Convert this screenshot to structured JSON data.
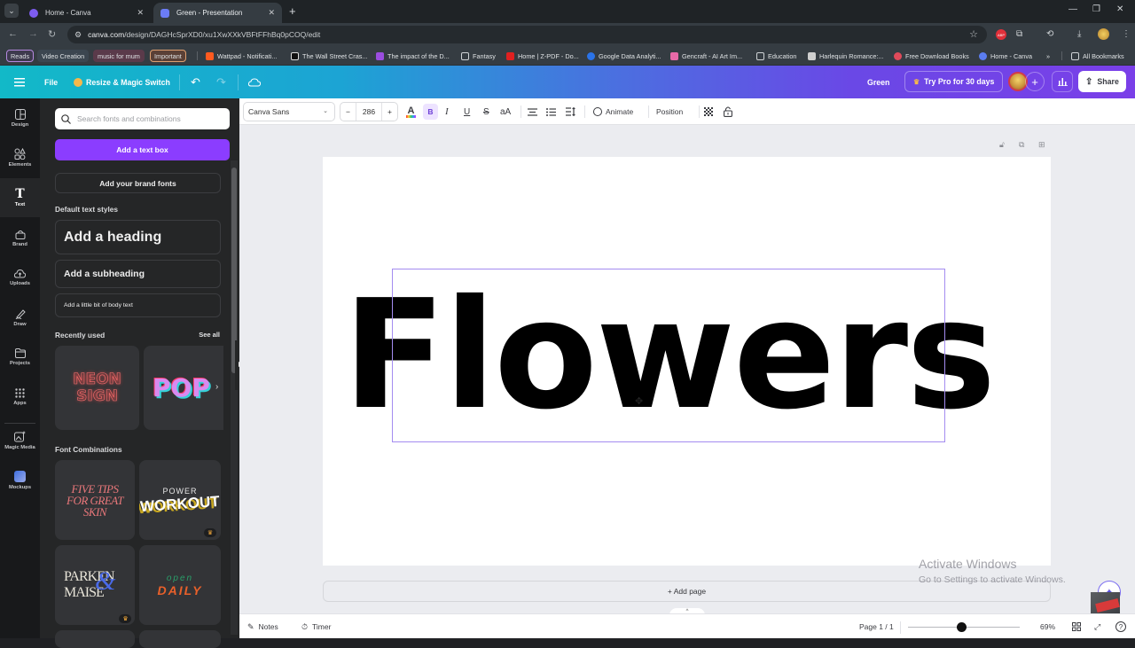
{
  "browser": {
    "tabs": [
      {
        "title": "Home - Canva",
        "active": false,
        "favicon_color": "#7d5cf0"
      },
      {
        "title": "Green - Presentation",
        "active": true,
        "favicon_color": "#6b7cf5"
      }
    ],
    "new_tab": "+",
    "window_controls": {
      "minimize": "—",
      "maximize": "❐",
      "close": "✕"
    },
    "url": {
      "domain": "canva.com",
      "path": "/design/DAGHcSprXD0/xu1XwXXkVBFtFFhBq0pCOQ/edit"
    },
    "bookmarks": [
      {
        "label": "Reads",
        "type": "group",
        "color": "#b589e0"
      },
      {
        "label": "Video Creation",
        "type": "group",
        "color": "#8ea6c0"
      },
      {
        "label": "music for mum",
        "type": "group",
        "color": "#d67ea0"
      },
      {
        "label": "Important",
        "type": "group",
        "color": "#e0a070"
      },
      {
        "label": "Wattpad - Notificati...",
        "type": "link",
        "icon": "wattpad-icon",
        "color": "#ff5a1f"
      },
      {
        "label": "The Wall Street Cras...",
        "type": "link",
        "icon": "h-icon",
        "color": "#111111"
      },
      {
        "label": "The impact of the D...",
        "type": "link",
        "icon": "book-icon",
        "color": "#9b4de0"
      },
      {
        "label": "Fantasy",
        "type": "folder"
      },
      {
        "label": "Home | Z-PDF - Do...",
        "type": "link",
        "icon": "z-icon",
        "color": "#e02020"
      },
      {
        "label": "Google Data Analyti...",
        "type": "link",
        "icon": "coursera-icon",
        "color": "#2a73e8"
      },
      {
        "label": "Gencraft - AI Art Im...",
        "type": "link",
        "icon": "gencraft-icon",
        "color": "#e86aa8"
      },
      {
        "label": "Education",
        "type": "folder"
      },
      {
        "label": "Harlequin Romance:...",
        "type": "link",
        "icon": "harlequin-icon",
        "color": "#cfcfcf"
      },
      {
        "label": "Free Download Books",
        "type": "link",
        "icon": "books-icon",
        "color": "#e04a5a"
      },
      {
        "label": "Home - Canva",
        "type": "link",
        "icon": "canva-icon",
        "color": "#5b7df0"
      }
    ],
    "overflow": "»",
    "all_bookmarks": "All Bookmarks"
  },
  "header": {
    "file": "File",
    "resize": "Resize & Magic Switch",
    "design_name": "Green",
    "try_pro": "Try Pro for 30 days",
    "share": "Share"
  },
  "rail": [
    {
      "label": "Design",
      "icon": "design-icon",
      "active": false
    },
    {
      "label": "Elements",
      "icon": "elements-icon",
      "active": false
    },
    {
      "label": "Text",
      "icon": "text-icon",
      "active": true
    },
    {
      "label": "Brand",
      "icon": "brand-icon",
      "active": false
    },
    {
      "label": "Uploads",
      "icon": "uploads-icon",
      "active": false
    },
    {
      "label": "Draw",
      "icon": "draw-icon",
      "active": false
    },
    {
      "label": "Projects",
      "icon": "projects-icon",
      "active": false
    },
    {
      "label": "Apps",
      "icon": "apps-icon",
      "active": false
    },
    {
      "label": "Magic Media",
      "icon": "magic-media-icon",
      "active": false
    },
    {
      "label": "Mockups",
      "icon": "mockups-icon",
      "active": false
    }
  ],
  "panel": {
    "search_placeholder": "Search fonts and combinations",
    "add_text_box": "Add a text box",
    "add_brand_fonts": "Add your brand fonts",
    "default_styles_title": "Default text styles",
    "heading": "Add a heading",
    "subheading": "Add a subheading",
    "body": "Add a little bit of body text",
    "recently_used_title": "Recently used",
    "see_all": "See all",
    "recent": [
      {
        "line1": "NEON",
        "line2": "SIGN"
      },
      {
        "line1": "POP"
      }
    ],
    "font_combinations_title": "Font Combinations",
    "combos": [
      {
        "lines": [
          "FIVE TIPS",
          "FOR GREAT",
          "SKIN"
        ],
        "pro": false
      },
      {
        "lines": [
          "POWER",
          "WORKOUT"
        ],
        "pro": true
      },
      {
        "lines": [
          "PARKEN",
          "MAISE"
        ],
        "pro": true
      },
      {
        "lines": [
          "open",
          "DAILY"
        ],
        "pro": false
      }
    ]
  },
  "toolbar": {
    "font": "Canva Sans",
    "size_minus": "−",
    "font_size": "286",
    "size_plus": "+",
    "animate": "Animate",
    "position": "Position"
  },
  "canvas": {
    "text": "Flowers",
    "add_page": "+ Add page"
  },
  "footer": {
    "notes": "Notes",
    "timer": "Timer",
    "page": "Page 1 / 1",
    "zoom_percent": "69%",
    "zoom_fraction": 0.48
  },
  "watermark": {
    "title": "Activate Windows",
    "subtitle": "Go to Settings to activate Windows."
  }
}
